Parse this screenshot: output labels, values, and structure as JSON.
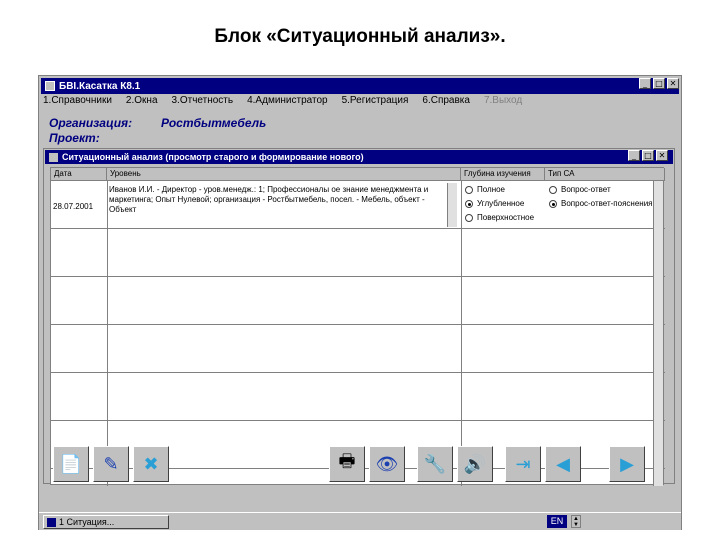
{
  "slide_title": "Блок «Ситуационный анализ».",
  "window": {
    "title": "БВІ.Касатка К8.1"
  },
  "menu": [
    {
      "label": "1.Справочники"
    },
    {
      "label": "2.Окна"
    },
    {
      "label": "3.Отчетность"
    },
    {
      "label": "4.Администратор"
    },
    {
      "label": "5.Регистрация"
    },
    {
      "label": "6.Справка"
    },
    {
      "label": "7.Выход",
      "disabled": true
    }
  ],
  "info": {
    "org_label": "Организация:",
    "org_value": "Ростбытмебель",
    "project_label": "Проект:",
    "project_value": ""
  },
  "dialog": {
    "title": "Ситуационный анализ (просмотр старого и формирование нового)",
    "columns": {
      "date": "Дата",
      "level": "Уровень",
      "depth": "Глубина изучения",
      "type": "Тип СА"
    },
    "row": {
      "date": "28.07.2001",
      "level_text": "Иванов И.И. - Директор - уров.менедж.: 1; Профессионалы ое знание менеджмента и маркетинга; Опыт Нулевой; организация - Ростбытмебель, посел. - Мебель, объект - Объект",
      "depth_options": [
        {
          "label": "Полное",
          "selected": false
        },
        {
          "label": "Углубленное",
          "selected": true
        },
        {
          "label": "Поверхностное",
          "selected": false
        }
      ],
      "type_options": [
        {
          "label": "Вопрос-ответ",
          "selected": false
        },
        {
          "label": "Вопрос-ответ-пояснения",
          "selected": true
        }
      ]
    }
  },
  "toolbar": {
    "buttons": [
      "new-doc-icon",
      "pencil-icon",
      "delete-x-icon",
      "print-icon",
      "eye-icon",
      "tool-icon",
      "sound-icon",
      "exit-door-icon",
      "arrow-left-icon",
      "arrow-right-icon"
    ]
  },
  "statusbar": {
    "task_label": "1 Ситуация...",
    "lang": "EN"
  }
}
